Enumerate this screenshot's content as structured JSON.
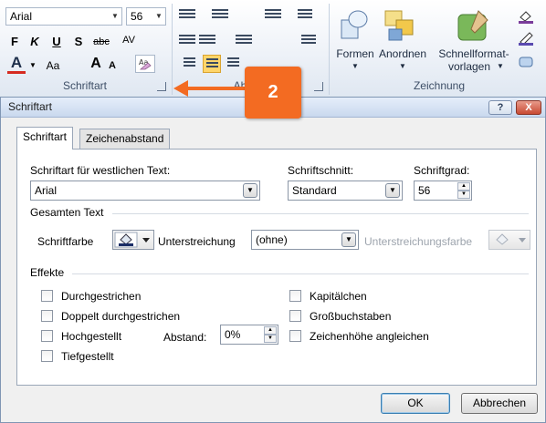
{
  "ribbon": {
    "font_name": "Arial",
    "font_size": "56",
    "bold": "F",
    "italic": "K",
    "underline": "U",
    "shadow": "S",
    "strike": "abc",
    "spacing": "AV",
    "font_color": "A",
    "change_case": "Aa",
    "grow": "A",
    "shrink": "A",
    "groups": {
      "font": "Schriftart",
      "paragraph": "Absatz",
      "drawing": "Zeichnung"
    },
    "shapes_label": "Formen",
    "arrange_label": "Anordnen",
    "quick_styles_label_1": "Schnellformat-",
    "quick_styles_label_2": "vorlagen"
  },
  "callout": {
    "number": "2"
  },
  "dialog": {
    "title": "Schriftart",
    "help": "?",
    "close": "X",
    "tabs": [
      "Schriftart",
      "Zeichenabstand"
    ],
    "western_font_label": "Schriftart für westlichen Text:",
    "western_font_value": "Arial",
    "style_label": "Schriftschnitt:",
    "style_value": "Standard",
    "size_label": "Schriftgrad:",
    "size_value": "56",
    "all_text_header": "Gesamten Text",
    "font_color_label": "Schriftfarbe",
    "underline_label": "Unterstreichung",
    "underline_value": "(ohne)",
    "underline_color_label": "Unterstreichungsfarbe",
    "effects_header": "Effekte",
    "effects_left": [
      "Durchgestrichen",
      "Doppelt durchgestrichen",
      "Hochgestellt",
      "Tiefgestellt"
    ],
    "effects_right": [
      "Kapitälchen",
      "Großbuchstaben",
      "Zeichenhöhe angleichen"
    ],
    "offset_label": "Abstand:",
    "offset_value": "0%",
    "ok": "OK",
    "cancel": "Abbrechen"
  },
  "colors": {
    "callout": "#f36b22",
    "active_button": "#ffd56a"
  }
}
